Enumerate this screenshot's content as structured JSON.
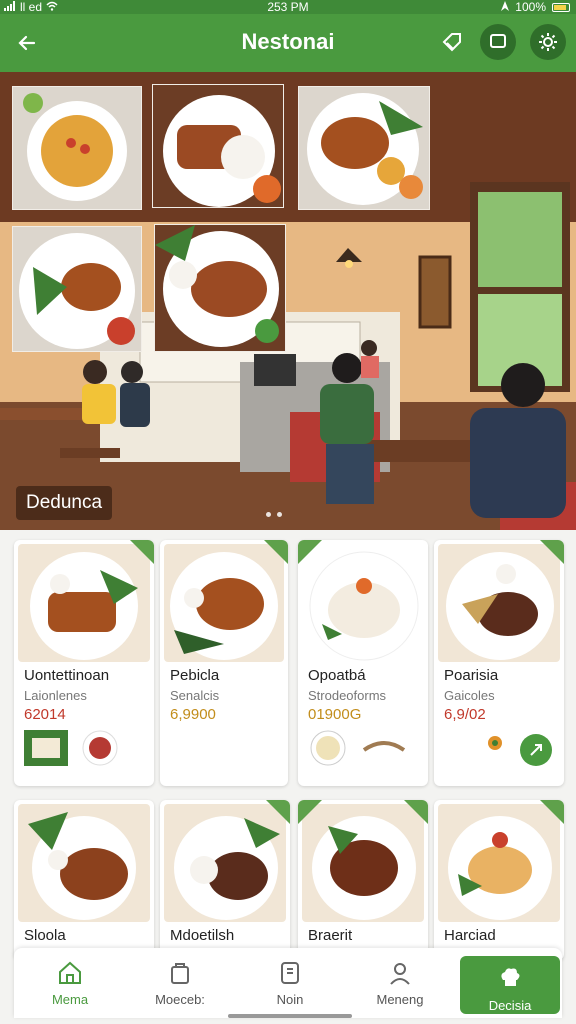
{
  "status": {
    "carrier": "ll ed",
    "time": "253 PM",
    "battery": "100%"
  },
  "header": {
    "title": "Nestonai"
  },
  "hero": {
    "caption": "Dedunca",
    "page_indicator": "2 dots"
  },
  "dishes": [
    {
      "name": "Uontettinoan",
      "subtitle": "Laionlenes",
      "price": "62014",
      "price_color": "#c1392b"
    },
    {
      "name": "Pebicla",
      "subtitle": "Senalcis",
      "price": "6,9900",
      "price_color": "#c28d1b"
    },
    {
      "name": "Opoatbá",
      "subtitle": "Strodeoforms",
      "price": "01900G",
      "price_color": "#c28d1b"
    },
    {
      "name": "Poarisia",
      "subtitle": "Gaicoles",
      "price": "6,9/02",
      "price_color": "#c1392b"
    },
    {
      "name": "Sloola"
    },
    {
      "name": "Mdoetilsh"
    },
    {
      "name": "Braerit"
    },
    {
      "name": "Harciad"
    }
  ],
  "nav": {
    "items": [
      {
        "label": "Mema",
        "icon": "home-icon"
      },
      {
        "label": "Moeceb:",
        "icon": "bag-icon"
      },
      {
        "label": "Noin",
        "icon": "receipt-icon"
      },
      {
        "label": "Meneng",
        "icon": "person-icon"
      },
      {
        "label": "Decisia",
        "icon": "chef-hat-icon"
      }
    ]
  },
  "colors": {
    "brand_green": "#4a9a3f",
    "price_red": "#c1392b",
    "price_gold": "#c28d1b"
  }
}
